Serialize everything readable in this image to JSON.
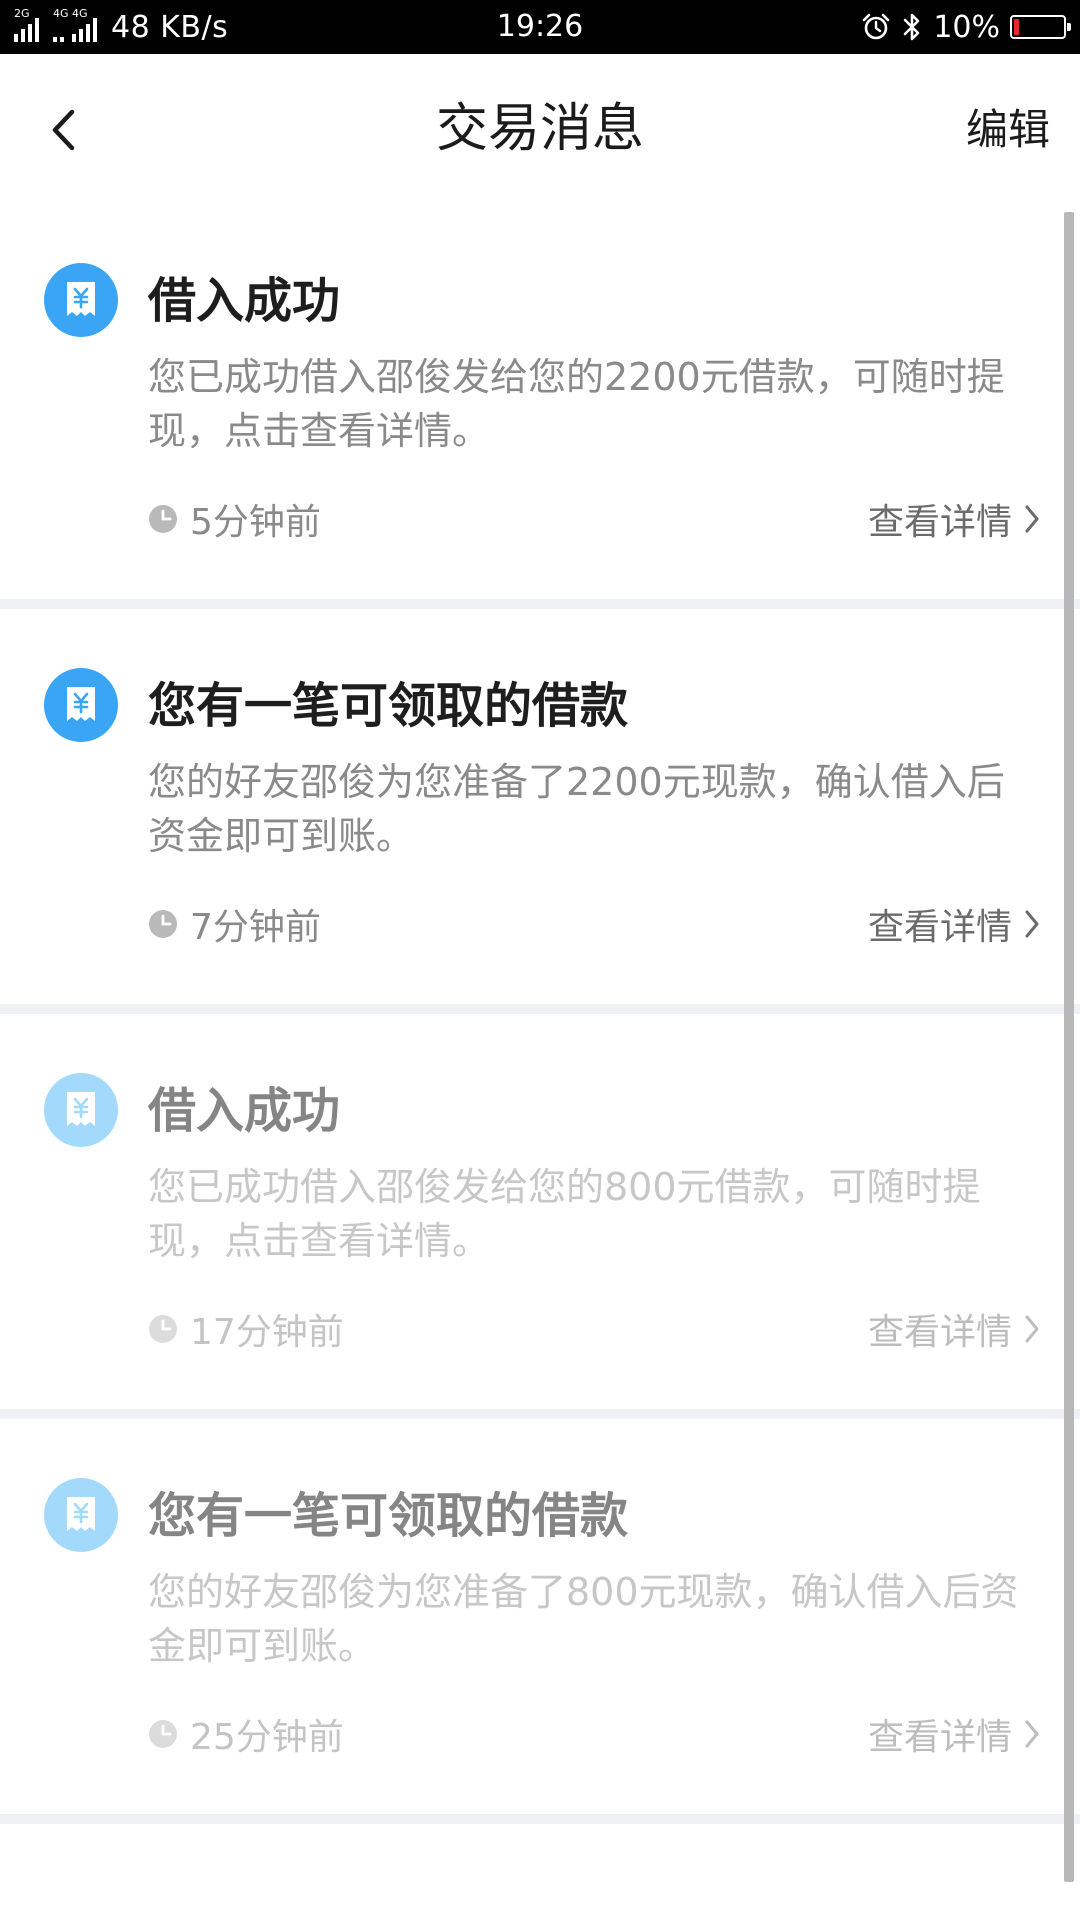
{
  "status_bar": {
    "network_1": "2G",
    "network_2": "4G",
    "network_3": "4G",
    "speed": "48 KB/s",
    "time": "19:26",
    "alarm_icon": "alarm-clock-icon",
    "bluetooth_icon": "bluetooth-icon",
    "battery_percent": "10%",
    "battery_level": 0.1,
    "battery_color": "#e8262b"
  },
  "nav": {
    "back_icon": "chevron-left-icon",
    "title": "交易消息",
    "edit_label": "编辑"
  },
  "colors": {
    "accent_unread": "#3ba5f5",
    "accent_read": "#a3dafb",
    "divider": "#f0f1f5"
  },
  "messages": [
    {
      "icon": "receipt-yen-icon",
      "title": "借入成功",
      "body": "您已成功借入邵俊发给您的2200元借款，可随时提现，点击查看详情。",
      "time": "5分钟前",
      "link_label": "查看详情",
      "read": false
    },
    {
      "icon": "receipt-yen-icon",
      "title": "您有一笔可领取的借款",
      "body": "您的好友邵俊为您准备了2200元现款，确认借入后资金即可到账。",
      "time": "7分钟前",
      "link_label": "查看详情",
      "read": false
    },
    {
      "icon": "receipt-yen-icon",
      "title": "借入成功",
      "body": "您已成功借入邵俊发给您的800元借款，可随时提现，点击查看详情。",
      "time": "17分钟前",
      "link_label": "查看详情",
      "read": true
    },
    {
      "icon": "receipt-yen-icon",
      "title": "您有一笔可领取的借款",
      "body": "您的好友邵俊为您准备了800元现款，确认借入后资金即可到账。",
      "time": "25分钟前",
      "link_label": "查看详情",
      "read": true
    }
  ]
}
